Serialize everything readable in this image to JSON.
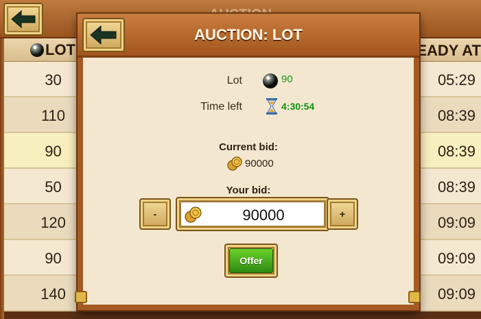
{
  "background": {
    "title": "AUCTION",
    "columns": {
      "lot": "LOT",
      "ready": "READY AT"
    },
    "rows": [
      {
        "lot": "30",
        "ready": "05:29"
      },
      {
        "lot": "110",
        "ready": "08:39"
      },
      {
        "lot": "90",
        "ready": "08:39"
      },
      {
        "lot": "50",
        "ready": "08:39"
      },
      {
        "lot": "120",
        "ready": "09:09"
      },
      {
        "lot": "90",
        "ready": "09:09"
      },
      {
        "lot": "140",
        "ready": "09:09"
      }
    ]
  },
  "modal": {
    "title": "AUCTION: LOT",
    "lot_label": "Lot",
    "lot_value": "90",
    "time_label": "Time left",
    "time_value": "4:30:54",
    "current_bid_label": "Current bid:",
    "current_bid_value": "90000",
    "your_bid_label": "Your bid:",
    "your_bid_value": "90000",
    "minus_label": "-",
    "plus_label": "+",
    "offer_label": "Offer"
  },
  "icons": {
    "back": "back-arrow-icon",
    "lot": "black-orb-icon",
    "time": "hourglass-icon",
    "currency": "gold-coins-icon"
  },
  "colors": {
    "frame_wood": "#a45a22",
    "panel_parchment": "#f3e7cf",
    "green_value": "#169a16",
    "offer_green": "#3fa518"
  }
}
